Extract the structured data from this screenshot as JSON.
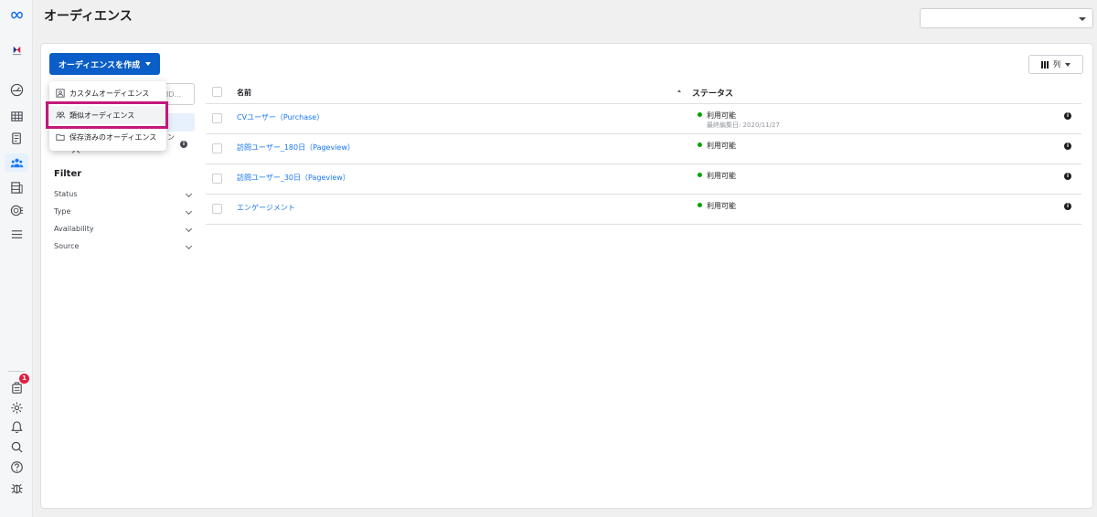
{
  "page": {
    "title": "オーディエンス"
  },
  "rail": {
    "top_icons": [
      "meta-logo-icon",
      "brand-logo-icon"
    ],
    "nav_icons": [
      "dashboard-icon",
      "table-icon",
      "pages-icon",
      "audience-icon",
      "database-icon",
      "events-icon",
      "menu-icon"
    ],
    "bottom_icons": [
      "notifications-page-icon",
      "settings-icon",
      "bell-icon",
      "search-icon",
      "help-icon",
      "bug-icon"
    ],
    "badge_count": "1"
  },
  "toolbar": {
    "create_label": "オーディエンスを作成",
    "columns_label": "列"
  },
  "menu": {
    "items": [
      {
        "label": "カスタムオーディエンス",
        "icon": "custom-audience-icon"
      },
      {
        "label": "類似オーディエンス",
        "icon": "lookalike-audience-icon"
      },
      {
        "label": "保存済みのオーディエンス",
        "icon": "saved-audience-icon"
      }
    ]
  },
  "sidebar": {
    "search_partial": "ID...",
    "partial_label": "ン",
    "filter_title": "Filter",
    "filters": [
      "Status",
      "Type",
      "Availability",
      "Source"
    ]
  },
  "table": {
    "headers": {
      "name": "名前",
      "status": "ステータス"
    },
    "rows": [
      {
        "name": "CVユーザー（Purchase）",
        "status": "利用可能",
        "sub": "最終編集日: 2020/11/27"
      },
      {
        "name": "訪問ユーザー_180日（Pageview）",
        "status": "利用可能",
        "sub": ""
      },
      {
        "name": "訪問ユーザー_30日（Pageview）",
        "status": "利用可能",
        "sub": ""
      },
      {
        "name": "エンゲージメント",
        "status": "利用可能",
        "sub": ""
      }
    ]
  },
  "colors": {
    "accent": "#0b5ec7",
    "link": "#1877f2",
    "highlight": "#c4177b",
    "available": "#00a400"
  }
}
